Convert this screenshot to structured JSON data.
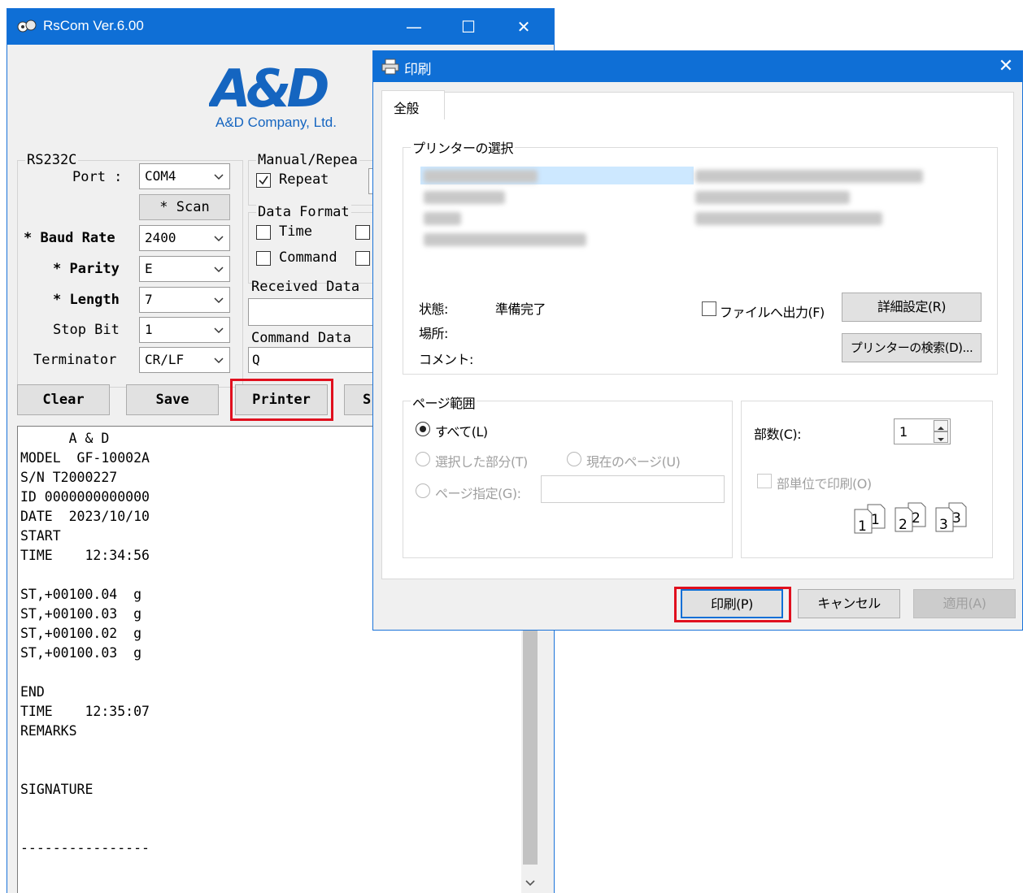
{
  "rscom": {
    "title": "RsCom Ver.6.00",
    "logo": {
      "text": "A&D",
      "company": "A&D Company, Ltd."
    },
    "rs232c": {
      "group_label": "RS232C",
      "port_label": "Port :",
      "port_value": "COM4",
      "scan_label": "* Scan",
      "baud_label": "* Baud Rate",
      "baud_value": "2400",
      "parity_label": "* Parity",
      "parity_value": "E",
      "length_label": "* Length",
      "length_value": "7",
      "stopbit_label": "Stop Bit",
      "stopbit_value": "1",
      "terminator_label": "Terminator",
      "terminator_value": "CR/LF"
    },
    "manual_repeat": {
      "group_label": "Manual/Repea",
      "repeat_label": "Repeat",
      "repeat_checked": true
    },
    "data_format": {
      "group_label": "Data Format",
      "time_label": "Time",
      "command_label": "Command"
    },
    "received_data_label": "Received Data",
    "command_data": {
      "label": "Command Data",
      "value": "Q"
    },
    "buttons": {
      "clear": "Clear",
      "save": "Save",
      "printer": "Printer",
      "partial": "S"
    },
    "terminal_lines": [
      "      A & D",
      "MODEL  GF-10002A",
      "S/N T2000227",
      "ID 0000000000000",
      "DATE  2023/10/10",
      "START",
      "TIME    12:34:56",
      "",
      "ST,+00100.04  g",
      "ST,+00100.03  g",
      "ST,+00100.02  g",
      "ST,+00100.03  g",
      "",
      "END",
      "TIME    12:35:07",
      "REMARKS",
      "",
      "",
      "SIGNATURE",
      "",
      "",
      "----------------"
    ]
  },
  "print_dialog": {
    "title": "印刷",
    "tab_general": "全般",
    "printer_select_label": "プリンターの選択",
    "status_label": "状態:",
    "status_value": "準備完了",
    "location_label": "場所:",
    "comment_label": "コメント:",
    "file_output_label": "ファイルへ出力(F)",
    "advanced_button": "詳細設定(R)",
    "find_printer_button": "プリンターの検索(D)...",
    "page_range_label": "ページ範囲",
    "all_label": "すべて(L)",
    "selection_label": "選択した部分(T)",
    "current_page_label": "現在のページ(U)",
    "pages_label": "ページ指定(G):",
    "copies_label": "部数(C):",
    "copies_value": "1",
    "collate_label": "部単位で印刷(O)",
    "collate_pages": [
      "1",
      "1",
      "2",
      "2",
      "3",
      "3"
    ],
    "print_button": "印刷(P)",
    "cancel_button": "キャンセル",
    "apply_button": "適用(A)"
  },
  "colors": {
    "titlebar": "#0f6fd6",
    "highlight": "#e0101e",
    "logo_blue": "#1565c0"
  }
}
